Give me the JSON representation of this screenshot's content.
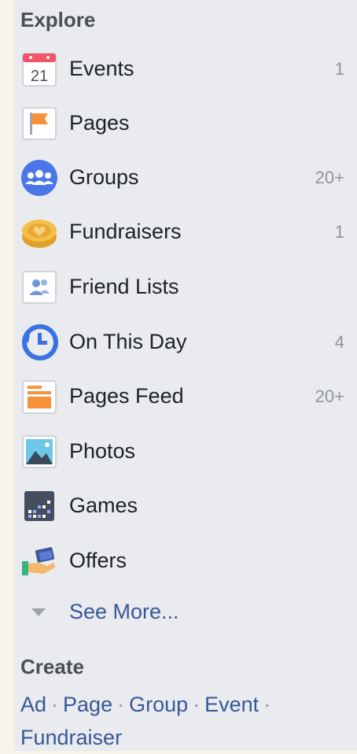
{
  "explore": {
    "title": "Explore",
    "items": [
      {
        "label": "Events",
        "count": "1",
        "icon": "calendar-icon",
        "icon_text": "21"
      },
      {
        "label": "Pages",
        "count": "",
        "icon": "flag-icon"
      },
      {
        "label": "Groups",
        "count": "20+",
        "icon": "groups-icon"
      },
      {
        "label": "Fundraisers",
        "count": "1",
        "icon": "fundraiser-heart-icon"
      },
      {
        "label": "Friend Lists",
        "count": "",
        "icon": "friend-list-icon"
      },
      {
        "label": "On This Day",
        "count": "4",
        "icon": "clock-history-icon"
      },
      {
        "label": "Pages Feed",
        "count": "20+",
        "icon": "newsfeed-icon"
      },
      {
        "label": "Photos",
        "count": "",
        "icon": "photos-icon"
      },
      {
        "label": "Games",
        "count": "",
        "icon": "games-icon"
      },
      {
        "label": "Offers",
        "count": "",
        "icon": "offers-icon"
      }
    ],
    "see_more": "See More..."
  },
  "create": {
    "title": "Create",
    "links": [
      "Ad",
      "Page",
      "Group",
      "Event",
      "Fundraiser"
    ],
    "separator": "·"
  },
  "colors": {
    "panel_bg": "#e9ebee",
    "link": "#365899",
    "text": "#1d2129",
    "muted": "#90949c"
  }
}
